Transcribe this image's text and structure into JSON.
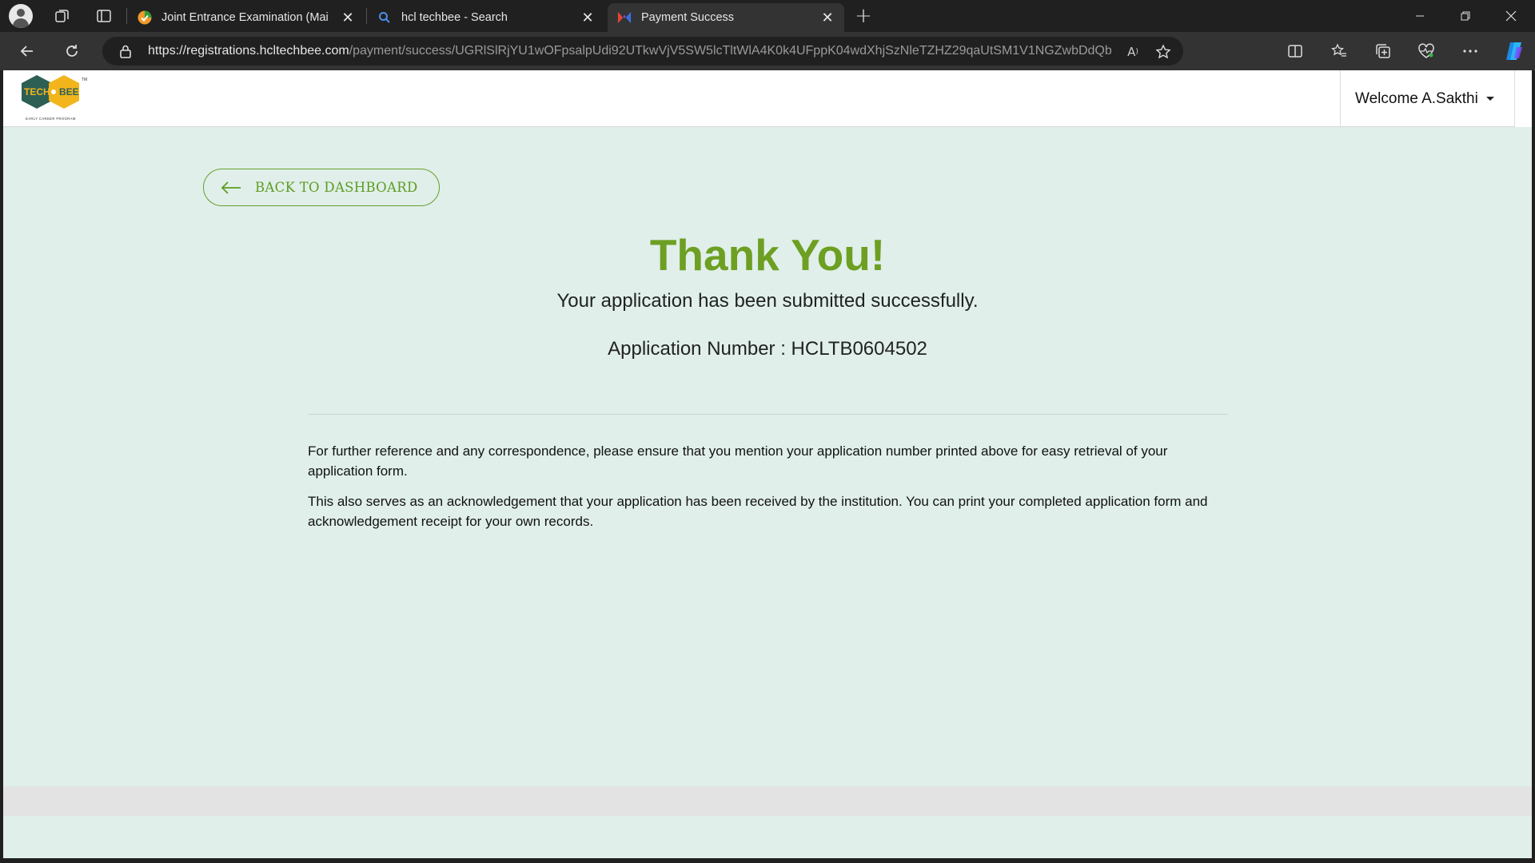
{
  "browser": {
    "tabs": [
      {
        "title": "Joint Entrance Examination (Mai",
        "favicon": "shield-check-icon",
        "active": false
      },
      {
        "title": "hcl techbee - Search",
        "favicon": "search-icon",
        "active": false
      },
      {
        "title": "Payment Success",
        "favicon": "techbee-favicon",
        "active": true
      }
    ],
    "url_host": "https://registrations.hcltechbee.com",
    "url_path": "/payment/success/UGRlSlRjYU1wOFpsalpUdi92UTkwVjV5SW5lcTltWlA4K0k4UFppK04wdXhjSzNleTZHZ29qaUtSM1V1NGZwbDdQb..."
  },
  "header": {
    "logo_text": "TECH BEE",
    "logo_tagline": "EARLY CAREER PROGRAM",
    "welcome": "Welcome A.Sakthi"
  },
  "main": {
    "back_label": "BACK TO DASHBOARD",
    "title": "Thank You!",
    "subtitle": "Your application has been submitted successfully.",
    "application_number": "Application Number : HCLTB0604502",
    "paragraph1": "For further reference and any correspondence, please ensure that you mention your application number printed above for easy retrieval of your application form.",
    "paragraph2": "This also serves as an acknowledgement that your application has been received by the institution. You can print your completed application form and acknowledgement receipt for your own records."
  },
  "colors": {
    "accent": "#6d9f22",
    "page_bg": "#e0efea",
    "chrome_bg": "#202020"
  }
}
